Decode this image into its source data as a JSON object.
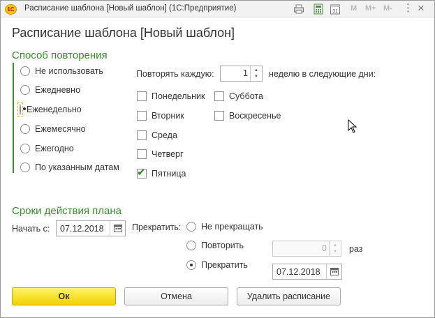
{
  "window": {
    "title": "Расписание шаблона [Новый шаблон]  (1С:Предприятие)",
    "app_logo": "1С",
    "toolbar": {
      "m": "M",
      "m_plus": "M+",
      "m_minus": "M-",
      "more": "⋮",
      "close": "×",
      "calendar_day": "31"
    }
  },
  "page_title": "Расписание шаблона [Новый шаблон]",
  "repeat": {
    "title": "Способ повторения",
    "options": [
      {
        "label": "Не использовать",
        "checked": false
      },
      {
        "label": "Ежедневно",
        "checked": false
      },
      {
        "label": "Еженедельно",
        "checked": true
      },
      {
        "label": "Ежемесячно",
        "checked": false
      },
      {
        "label": "Ежегодно",
        "checked": false
      },
      {
        "label": "По указанным датам",
        "checked": false
      }
    ],
    "every_label": "Повторять каждую:",
    "every_value": "1",
    "weeks_label": "неделю в следующие дни:",
    "days": [
      {
        "label": "Понедельник",
        "checked": false
      },
      {
        "label": "Вторник",
        "checked": false
      },
      {
        "label": "Среда",
        "checked": false
      },
      {
        "label": "Четверг",
        "checked": false
      },
      {
        "label": "Пятница",
        "checked": true
      },
      {
        "label": "Суббота",
        "checked": false
      },
      {
        "label": "Воскресенье",
        "checked": false
      }
    ]
  },
  "term": {
    "title": "Сроки действия плана",
    "start_label": "Начать с:",
    "start_date": "07.12.2018",
    "stop_label": "Прекратить:",
    "stop_options": [
      {
        "label": "Не прекращать",
        "checked": false
      },
      {
        "label": "Повторить",
        "checked": false
      },
      {
        "label": "Прекратить",
        "checked": true
      }
    ],
    "repeat_count": "0",
    "times_label": "раз",
    "end_date": "07.12.2018"
  },
  "buttons": {
    "ok": "Ок",
    "cancel": "Отмена",
    "delete": "Удалить расписание"
  },
  "colors": {
    "accent_green": "#3a8a2e",
    "primary_yellow": "#f2d000"
  }
}
